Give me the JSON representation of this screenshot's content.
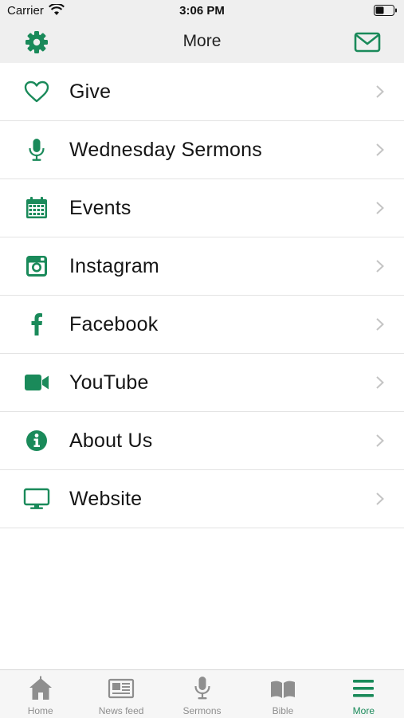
{
  "status_bar": {
    "carrier": "Carrier",
    "time": "3:06 PM"
  },
  "nav_bar": {
    "title": "More",
    "left_icon": "gear-icon",
    "right_icon": "mail-icon"
  },
  "menu": {
    "items": [
      {
        "label": "Give",
        "icon": "heart-icon"
      },
      {
        "label": "Wednesday Sermons",
        "icon": "microphone-icon"
      },
      {
        "label": "Events",
        "icon": "calendar-icon"
      },
      {
        "label": "Instagram",
        "icon": "instagram-icon"
      },
      {
        "label": "Facebook",
        "icon": "facebook-icon"
      },
      {
        "label": "YouTube",
        "icon": "video-camera-icon"
      },
      {
        "label": "About Us",
        "icon": "info-icon"
      },
      {
        "label": "Website",
        "icon": "monitor-icon"
      }
    ]
  },
  "tab_bar": {
    "tabs": [
      {
        "label": "Home",
        "icon": "home-icon"
      },
      {
        "label": "News feed",
        "icon": "newspaper-icon"
      },
      {
        "label": "Sermons",
        "icon": "microphone-icon"
      },
      {
        "label": "Bible",
        "icon": "book-icon"
      },
      {
        "label": "More",
        "icon": "menu-icon",
        "active": true
      }
    ]
  },
  "colors": {
    "accent": "#1a8a5a",
    "inactive": "#8e8e8e",
    "bar_background": "#efefef"
  }
}
